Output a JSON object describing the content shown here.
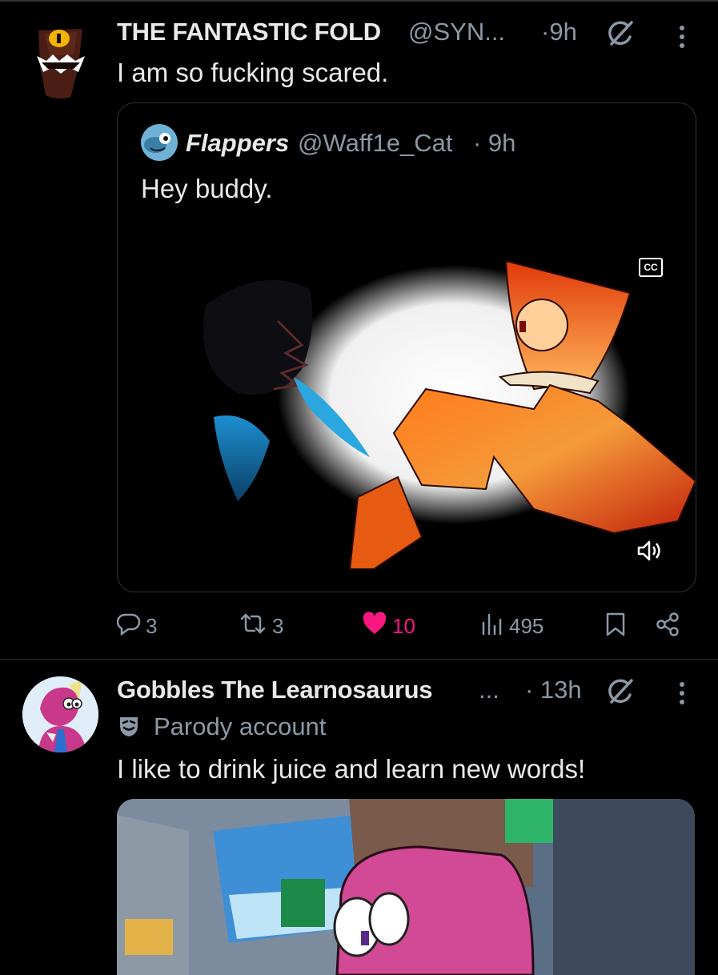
{
  "posts": [
    {
      "author_name": "THE FANTASTIC FOLD",
      "handle": "@SYN...",
      "time": "·9h",
      "text": "I am so fucking scared.",
      "quote": {
        "author_name": "Flappers",
        "handle": "@Waff1e_Cat",
        "time": "· 9h",
        "text": "Hey buddy.",
        "video": {
          "cc_label": "CC"
        }
      },
      "actions": {
        "replies": "3",
        "reposts": "3",
        "likes": "10",
        "views": "495"
      }
    },
    {
      "author_name": "Gobbles The Learnosaurus",
      "name_ellipsis": "...",
      "time": "· 13h",
      "badge_label": "Parody account",
      "text": "I like to drink juice and learn new words!"
    }
  ],
  "colors": {
    "like": "#f91880",
    "muted": "#8b98a5",
    "text": "#e7e9ea"
  },
  "icons": [
    "grok-icon",
    "more-icon",
    "reply-icon",
    "repost-icon",
    "heart-icon",
    "views-icon",
    "bookmark-icon",
    "share-icon",
    "cc-icon",
    "volume-icon",
    "parody-mask-icon"
  ]
}
